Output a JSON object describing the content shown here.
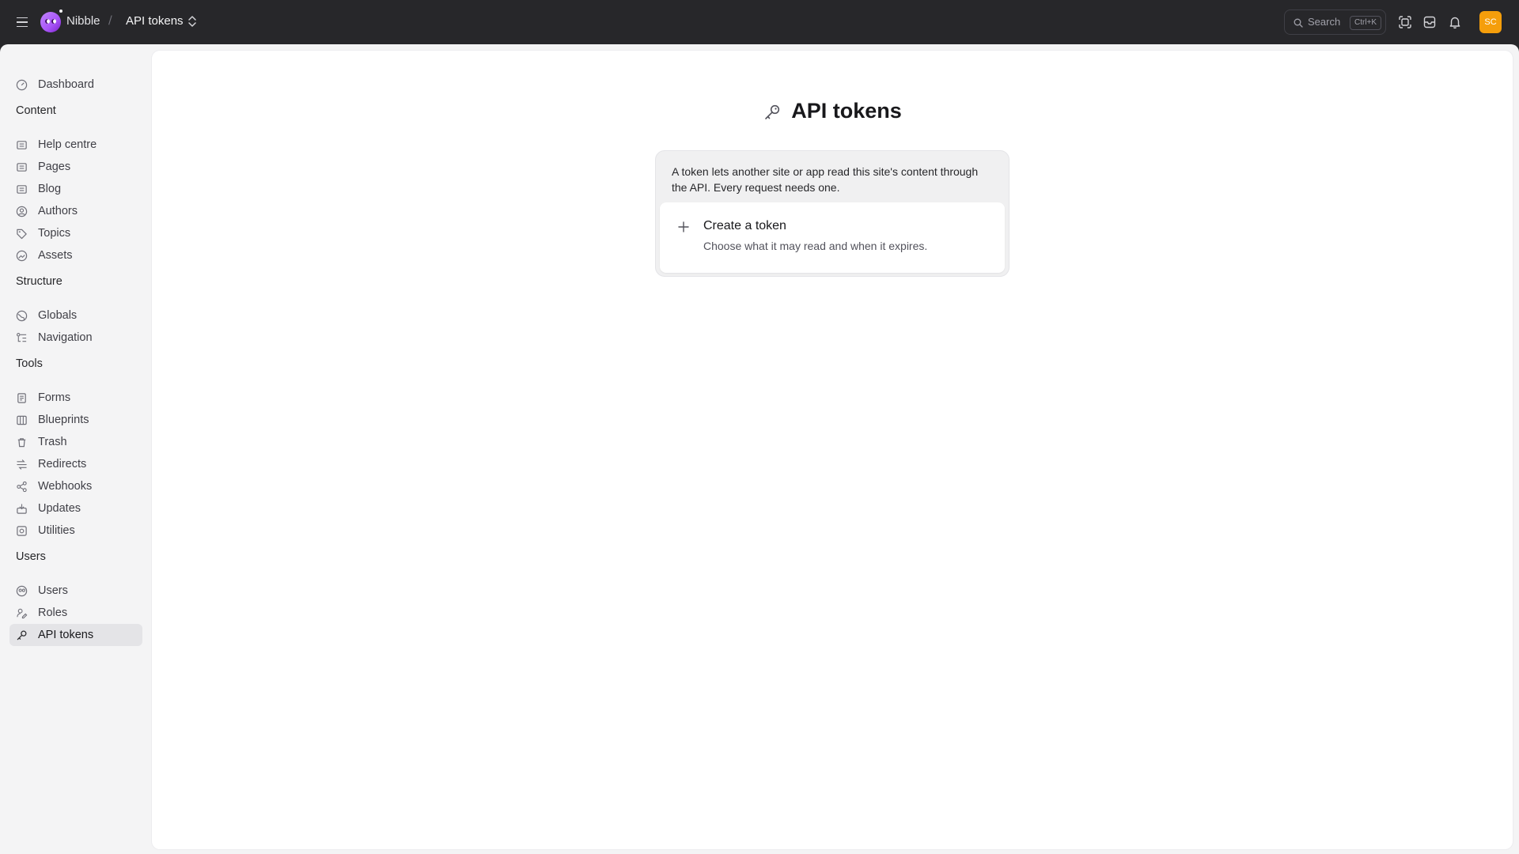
{
  "header": {
    "site_name": "Nibble",
    "breadcrumb_separator": "/",
    "breadcrumb_current": "API tokens",
    "search_label": "Search",
    "search_shortcut": "Ctrl+K",
    "avatar_initials": "SC",
    "avatar_color": "#f59e0b",
    "icons": [
      "menu-icon",
      "nibble-logo",
      "chevron-updown-icon",
      "search-icon",
      "screen-capture-icon",
      "inbox-icon",
      "bell-icon"
    ]
  },
  "sidebar": {
    "dashboard": {
      "label": "Dashboard",
      "icon": "dashboard-icon"
    },
    "sections": [
      {
        "title": "Content",
        "items": [
          {
            "label": "Help centre",
            "icon": "collection-icon"
          },
          {
            "label": "Pages",
            "icon": "collection-icon"
          },
          {
            "label": "Blog",
            "icon": "collection-icon"
          },
          {
            "label": "Authors",
            "icon": "user-circle-icon"
          },
          {
            "label": "Topics",
            "icon": "tag-icon"
          },
          {
            "label": "Assets",
            "icon": "assets-icon"
          }
        ]
      },
      {
        "title": "Structure",
        "items": [
          {
            "label": "Globals",
            "icon": "globe-icon"
          },
          {
            "label": "Navigation",
            "icon": "navigation-icon"
          }
        ]
      },
      {
        "title": "Tools",
        "items": [
          {
            "label": "Forms",
            "icon": "form-icon"
          },
          {
            "label": "Blueprints",
            "icon": "blueprint-icon"
          },
          {
            "label": "Trash",
            "icon": "trash-icon"
          },
          {
            "label": "Redirects",
            "icon": "redirect-icon"
          },
          {
            "label": "Webhooks",
            "icon": "webhook-icon"
          },
          {
            "label": "Updates",
            "icon": "updates-icon"
          },
          {
            "label": "Utilities",
            "icon": "utilities-icon"
          }
        ]
      },
      {
        "title": "Users",
        "items": [
          {
            "label": "Users",
            "icon": "users-icon"
          },
          {
            "label": "Roles",
            "icon": "roles-icon"
          },
          {
            "label": "API tokens",
            "icon": "key-icon",
            "active": true
          }
        ]
      }
    ]
  },
  "main": {
    "title": "API tokens",
    "title_icon": "key-icon",
    "intro": "A token lets another site or app read this site's content through the API. Every request needs one.",
    "create": {
      "title": "Create a token",
      "subtitle": "Choose what it may read and when it expires.",
      "icon": "plus-icon"
    }
  }
}
